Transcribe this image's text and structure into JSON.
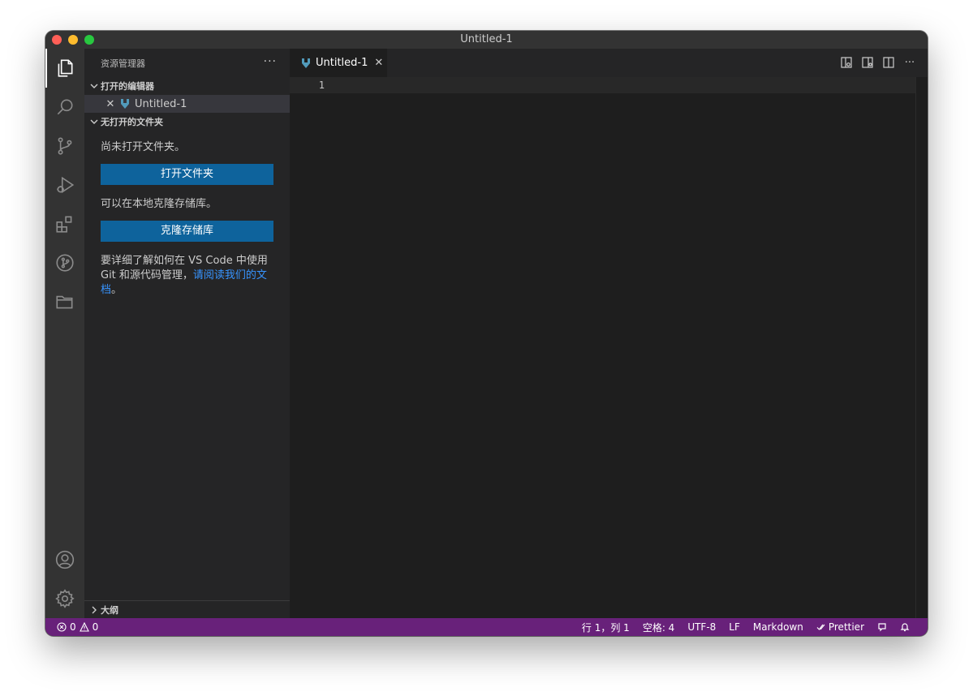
{
  "window": {
    "title": "Untitled-1"
  },
  "sidebar": {
    "title": "资源管理器",
    "more": "···",
    "open_editors": {
      "heading": "打开的编辑器",
      "items": [
        {
          "label": "Untitled-1"
        }
      ]
    },
    "no_folder": {
      "heading": "无打开的文件夹",
      "msg1": "尚未打开文件夹。",
      "open_button": "打开文件夹",
      "msg2": "可以在本地克隆存储库。",
      "clone_button": "克隆存储库",
      "msg3": "要详细了解如何在 VS Code 中使用 Git 和源代码管理，",
      "msg3_link": "请阅读我们的文档",
      "msg3_end": "。"
    },
    "outline": {
      "heading": "大纲"
    }
  },
  "editor": {
    "tab": {
      "label": "Untitled-1"
    },
    "line_numbers": [
      "1"
    ]
  },
  "statusbar": {
    "errors": "0",
    "warnings": "0",
    "position": "行 1，列 1",
    "spaces": "空格: 4",
    "encoding": "UTF-8",
    "eol": "LF",
    "language": "Markdown",
    "prettier": "Prettier"
  },
  "colors": {
    "statusbar": "#68217a",
    "button": "#0e639c",
    "link": "#3794ff",
    "markdown_icon": "#519aba"
  }
}
